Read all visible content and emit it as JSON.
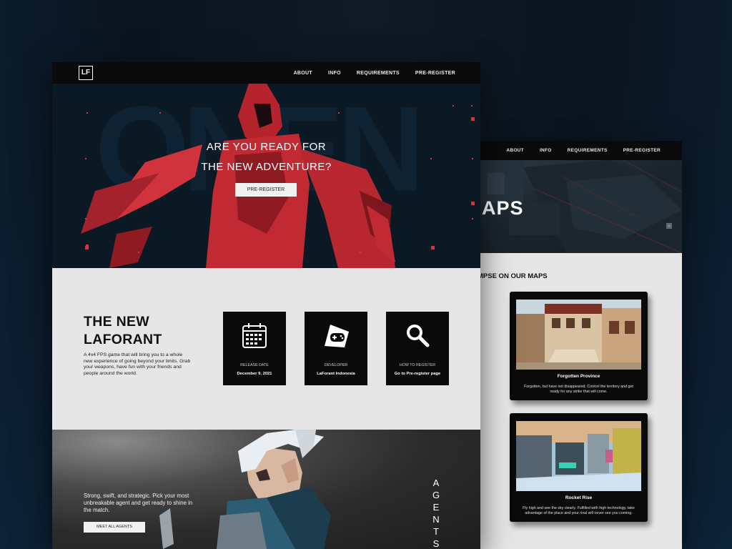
{
  "colors": {
    "page_bg": "#0b1520",
    "accent_red": "#e0303a",
    "nav_bg": "#0a0a0a",
    "light_section": "#e6e6e6"
  },
  "front": {
    "logo": "LF",
    "nav": [
      "ABOUT",
      "INFO",
      "REQUIREMENTS",
      "PRE-REGISTER"
    ],
    "hero": {
      "line1": "ARE YOU READY FOR",
      "line2": "THE NEW ADVENTURE?",
      "cta": "PRE-REGISTER"
    },
    "about": {
      "title_line1": "THE NEW",
      "title_line2": "LAFORANT",
      "description": "A 4v4 FPS game that will bring you to a whole new experience of going beyond your limits. Grab your weapons, have fun with your friends and people around the world.",
      "cards": [
        {
          "icon": "calendar-icon",
          "label": "RELEASE DATE",
          "value": "December 9, 2021"
        },
        {
          "icon": "gamepad-icon",
          "label": "DEVELOPER",
          "value": "LaForant Indonesia"
        },
        {
          "icon": "magnifier-icon",
          "label": "HOW TO REGISTER",
          "value": "Go to Pre-register page"
        }
      ]
    },
    "agents": {
      "description": "Strong, swift, and strategic. Pick your most unbreakable agent and get ready to shine in the match.",
      "cta": "MEET ALL AGENTS",
      "vertical_title": "AGENTS"
    }
  },
  "back": {
    "nav": [
      "ABOUT",
      "INFO",
      "REQUIREMENTS",
      "PRE-REGISTER"
    ],
    "hero_title": "APS",
    "scroll_icon": "chevron-down-icon",
    "glimpse_heading": "MPSE ON OUR MAPS",
    "maps": [
      {
        "name": "Forgotten Province",
        "description": "Forgotten, but have not disappeared. Control the territory and get ready for any strike that will come."
      },
      {
        "name": "Rocket Rise",
        "description": "Fly high and see the sky clearly. Fulfilled with high technology, take advantage of the place and your rival will never see you coming."
      }
    ]
  }
}
